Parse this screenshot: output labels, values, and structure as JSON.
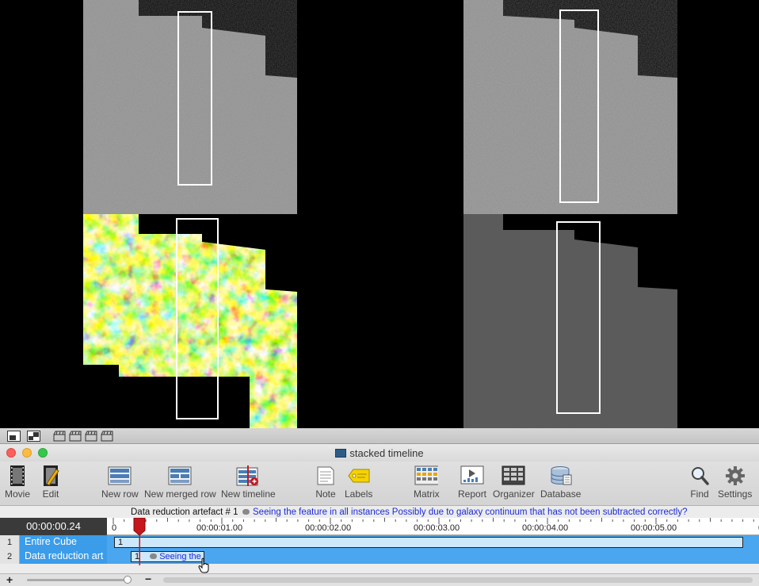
{
  "window": {
    "title": "stacked timeline"
  },
  "toolbar": {
    "movie": "Movie",
    "edit": "Edit",
    "new_row": "New row",
    "new_merged_row": "New merged row",
    "new_timeline": "New timeline",
    "note": "Note",
    "labels": "Labels",
    "matrix": "Matrix",
    "report": "Report",
    "organizer": "Organizer",
    "database": "Database",
    "find": "Find",
    "settings": "Settings"
  },
  "info": {
    "instance_name": "Data reduction artefact # 1",
    "comment": "Seeing the feature in all instances  Possibly due to galaxy continuum that has not been subtracted correctly?"
  },
  "timeline": {
    "timecode": "00:00:00.24",
    "ticks": [
      "0",
      "00:00:01.00",
      "00:00:02.00",
      "00:00:03.00",
      "00:00:04.00",
      "00:00:05.00",
      "00"
    ],
    "playhead_fraction": 0.24
  },
  "rows": [
    {
      "num": "1",
      "name": "Entire Cube",
      "clips": [
        {
          "label": "1",
          "note": ""
        }
      ]
    },
    {
      "num": "2",
      "name": "Data reduction art",
      "clips": [
        {
          "label": "1",
          "note": "Seeing the"
        }
      ]
    }
  ],
  "colors": {
    "row_blue": "#3b9cea",
    "playhead": "#c7161c",
    "comment_blue": "#1b2bd6"
  }
}
